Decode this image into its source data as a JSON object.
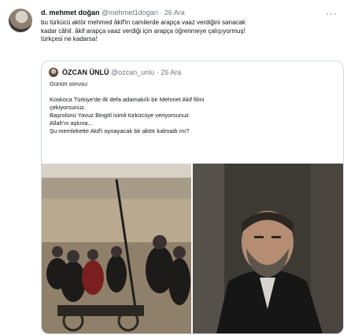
{
  "tweet": {
    "author_name": "d. mehmet doğan",
    "handle": "@mehmet1dogan",
    "separator": "·",
    "date": "26 Ara",
    "lines": [
      "bu türkücü aktör mehmed âkif'in camilerde arapça vaaz verdiğini sanacak",
      "kadar câhil. âkif arapça vaaz verdiği için arapça öğrenmeye çalışıyormuş!",
      "türkçesi ne kadarsa!"
    ]
  },
  "quoted": {
    "author_name": "ÖZCAN ÜNLÜ",
    "handle": "@ozcan_unlu",
    "separator": "·",
    "date": "26 Ara",
    "lines": [
      "Günün sorusu:",
      "",
      "Koskoca Türkiye'de ilk defa adamakıllı bir Mehmet Akif filmi",
      "çekiyorsunuz.",
      "Başrolünü Yavuz Bingöl isimli türkücüye veriyorsunuz.",
      "Allah'ın aşkına...",
      "Şu memlekette Akif'i oynayacak bir aktör kalmadı mı?"
    ]
  },
  "icons": {
    "more": "more-icon"
  }
}
